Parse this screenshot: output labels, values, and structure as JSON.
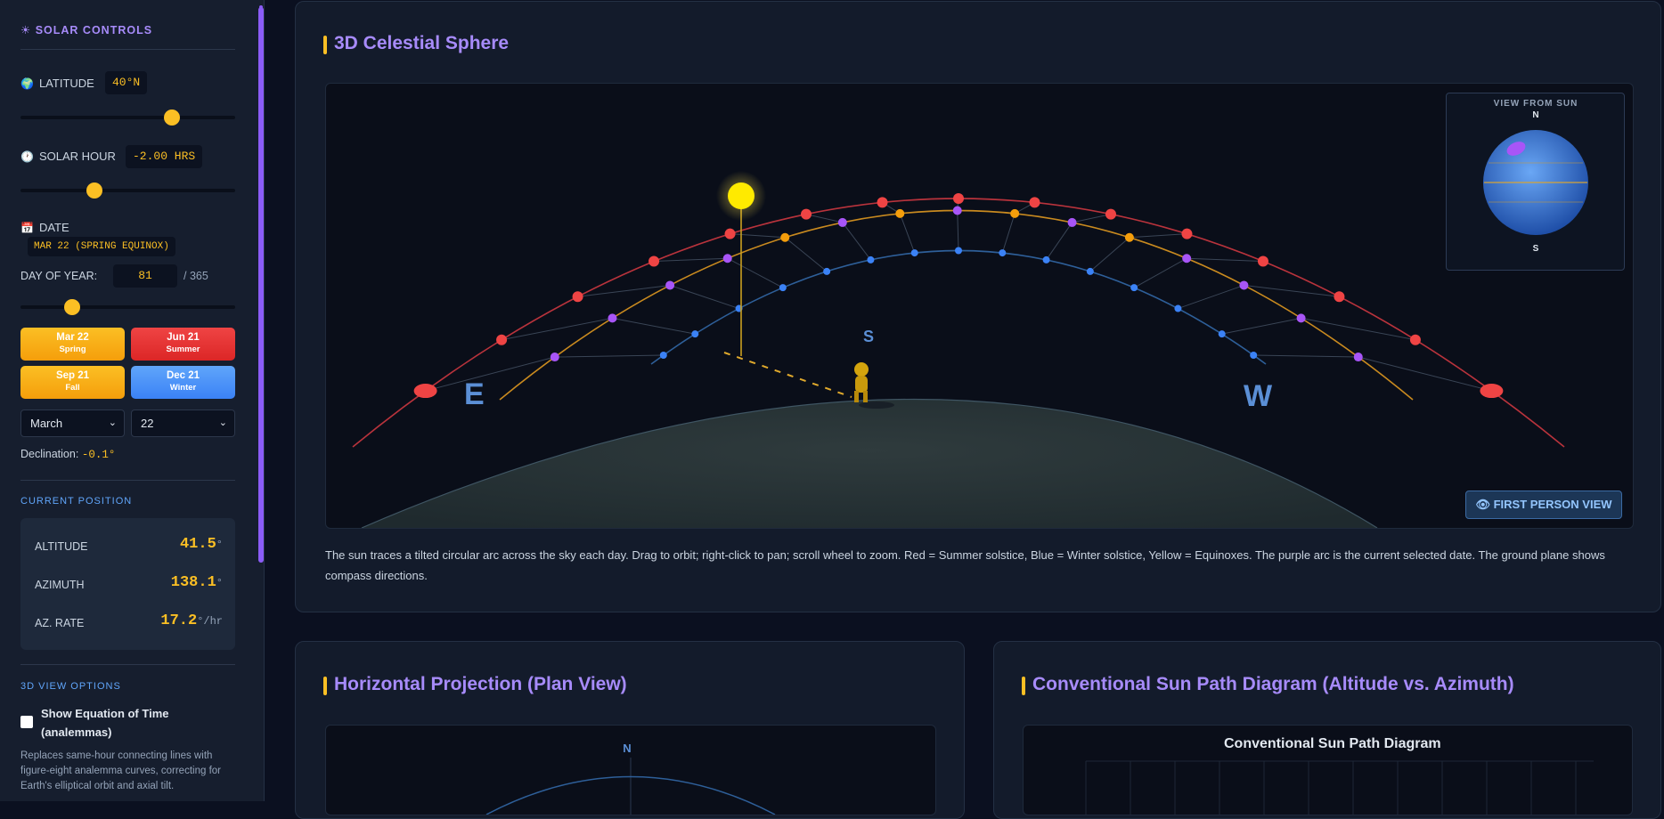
{
  "sidebar": {
    "title": "SOLAR CONTROLS",
    "latitude": {
      "label": "LATITUDE",
      "value": "40°N",
      "level": 0.72
    },
    "solar_hour": {
      "label": "SOLAR HOUR",
      "value": "-2.00 HRS",
      "level": 0.33
    },
    "date": {
      "label": "DATE",
      "value": "MAR 22 (SPRING EQUINOX)"
    },
    "day_of_year": {
      "label": "DAY OF YEAR:",
      "value": "81",
      "total": "/ 365",
      "level": 0.22
    },
    "presets": [
      {
        "title": "Mar 22",
        "sub": "Spring",
        "color": "#fbbf24"
      },
      {
        "title": "Jun 21",
        "sub": "Summer",
        "color": "#ef4444"
      },
      {
        "title": "Sep 21",
        "sub": "Fall",
        "color": "#fbbf24"
      },
      {
        "title": "Dec 21",
        "sub": "Winter",
        "color": "#60a5fa"
      }
    ],
    "month_select": "March",
    "day_select": "22",
    "declination_label": "Declination:",
    "declination_value": "-0.1°",
    "current_position": {
      "heading": "CURRENT POSITION",
      "altitude_label": "ALTITUDE",
      "altitude_value": "41.5",
      "altitude_unit": "°",
      "azimuth_label": "AZIMUTH",
      "azimuth_value": "138.1",
      "azimuth_unit": "°",
      "rate_label": "AZ. RATE",
      "rate_value": "17.2",
      "rate_unit": "°/hr"
    },
    "view_options": {
      "heading": "3D VIEW OPTIONS",
      "eot_label": "Show Equation of Time (analemmas)",
      "eot_checked": false,
      "eot_desc": "Replaces same-hour connecting lines with figure-eight analemma curves, correcting for Earth's elliptical orbit and axial tilt."
    }
  },
  "sphere": {
    "title": "3D Celestial Sphere",
    "east": "E",
    "west": "W",
    "south": "S",
    "inset_title": "VIEW FROM SUN",
    "inset_n": "N",
    "inset_s": "S",
    "first_person": "FIRST PERSON VIEW",
    "description": "The sun traces a tilted circular arc across the sky each day. Drag to orbit; right-click to pan; scroll wheel to zoom. Red = Summer solstice, Blue = Winter solstice, Yellow = Equinoxes. The purple arc is the current selected date. The ground plane shows compass directions.",
    "colors": {
      "summer": "#ef4444",
      "equinox": "#f59e0b",
      "winter": "#3b82f6",
      "current": "#a855f7",
      "sun": "#ffea00"
    }
  },
  "plan": {
    "title": "Horizontal Projection (Plan View)",
    "north": "N"
  },
  "sunpath": {
    "title": "Conventional Sun Path Diagram (Altitude vs. Azimuth)",
    "chart_title": "Conventional Sun Path Diagram"
  }
}
